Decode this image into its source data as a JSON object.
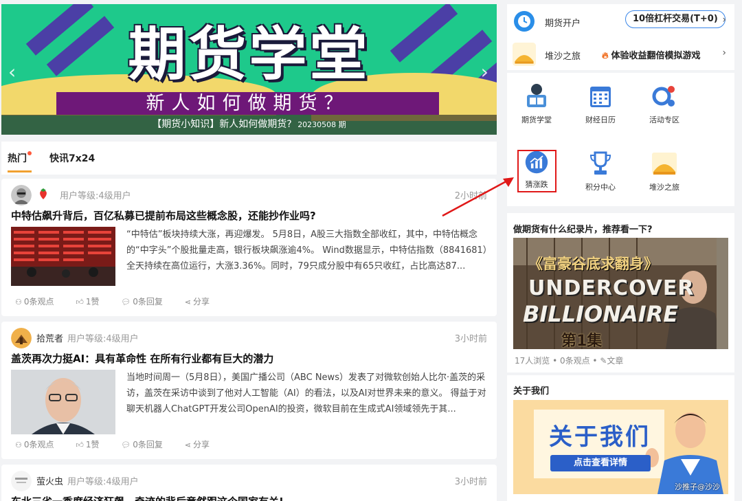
{
  "banner": {
    "title": "期货学堂",
    "subtitle": "新人如何做期货？",
    "caption": "【期货小知识】新人如何做期货?",
    "caption_date": "20230508 期",
    "prev_arrow": "‹",
    "next_arrow": "›"
  },
  "tabs": [
    {
      "label": "热门",
      "active": true
    },
    {
      "label": "快讯7x24",
      "active": false
    }
  ],
  "feed": [
    {
      "author": "",
      "level": "用户等级:4级用户",
      "time": "2小时前",
      "title": "中特估飙升背后，百亿私募已提前布局这些概念股，还能抄作业吗?",
      "summary": "“中特估”板块持续大涨，再迎爆发。 5月8日，A股三大指数全部收红，其中，中特估概念的“中字头”个股批量走高，银行板块飙涨逾4%。 Wind数据显示，中特估指数（8841681）全天持续在高位运行，大涨3.36%。同时，79只成分股中有65只收红，占比高达87...",
      "views": "0条观点",
      "likes": "1赞",
      "replies": "0条回复",
      "share": "分享"
    },
    {
      "author": "拾荒者",
      "level": "用户等级:4级用户",
      "time": "3小时前",
      "title": "盖茨再次力挺AI：具有革命性 在所有行业都有巨大的潜力",
      "summary": "当地时间周一（5月8日），美国广播公司（ABC News）发表了对微软创始人比尔·盖茨的采访，盖茨在采访中谈到了他对人工智能（AI）的看法，以及AI对世界未来的意义。 得益于对聊天机器人ChatGPT开发公司OpenAI的投资，微软目前在生成式AI领域领先于其...",
      "views": "0条观点",
      "likes": "1赞",
      "replies": "0条回复",
      "share": "分享"
    },
    {
      "author": "萤火虫",
      "level": "用户等级:4级用户",
      "time": "3小时前",
      "title": "东北三省一季度经济狂飙，奇迹的背后竟然跟这个国家有关!",
      "summary": "",
      "views": "",
      "likes": "",
      "replies": "",
      "share": ""
    }
  ],
  "sidebar": {
    "account": {
      "label": "期货开户",
      "pill": "10倍杠杆交易(T+0)"
    },
    "sandbox": {
      "label": "堆沙之旅",
      "promo": "体验收益翻倍模拟游戏"
    },
    "grid": [
      {
        "label": "期货学堂",
        "icon": "book-reader-icon"
      },
      {
        "label": "财经日历",
        "icon": "calendar-icon"
      },
      {
        "label": "活动专区",
        "icon": "activity-icon"
      },
      {
        "label": "猜涨跌",
        "icon": "trend-chart-icon"
      },
      {
        "label": "积分中心",
        "icon": "trophy-icon"
      },
      {
        "label": "堆沙之旅",
        "icon": "sand-pile-icon"
      }
    ],
    "doc_question": "做期货有什么纪录片，推荐看一下?",
    "doc_image_title_cn": "《富豪谷底求翻身》",
    "doc_image_title_en1": "UNDERCOVER",
    "doc_image_title_en2": "BILLIONAIRE",
    "doc_image_episode": "第1集",
    "doc_meta": "17人浏览 • 0条观点 • ✎文章",
    "about_title": "关于我们",
    "about_banner_title": "关于我们",
    "about_banner_button": "点击查看详情",
    "watermark": "沙推子@沙沙"
  },
  "colors": {
    "banner_green": "#1ec98b",
    "banner_purple": "#6e1878",
    "accent_orange": "#f0a030",
    "pill_border": "#3a86e8",
    "highlight_red": "#e01818"
  }
}
